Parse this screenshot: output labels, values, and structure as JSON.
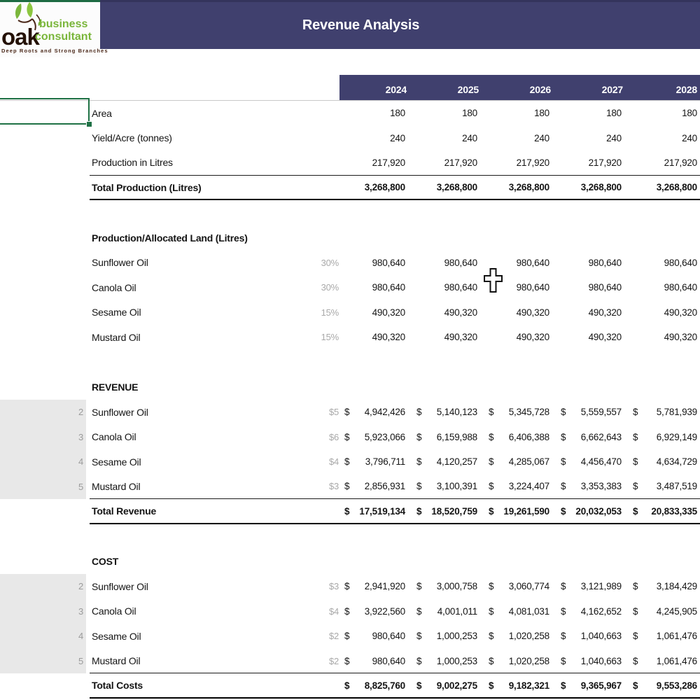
{
  "logo": {
    "brand": "oak",
    "line1": "business",
    "line2": "consultant",
    "tagline": "Deep Roots and Strong Branches"
  },
  "header": {
    "title": "Revenue Analysis"
  },
  "years": [
    "2024",
    "2025",
    "2026",
    "2027",
    "2028"
  ],
  "colors": {
    "banner": "#40406E",
    "selection_green": "#1F7145",
    "strip_gray": "#E8E8E8",
    "logo_green": "#7AB63B"
  },
  "table": {
    "rows": [
      {
        "type": "plain",
        "label": "Area",
        "values": [
          "180",
          "180",
          "180",
          "180",
          "180"
        ]
      },
      {
        "type": "plain",
        "label": "Yield/Acre (tonnes)",
        "values": [
          "240",
          "240",
          "240",
          "240",
          "240"
        ]
      },
      {
        "type": "plain",
        "label": "Production in Litres",
        "values": [
          "217,920",
          "217,920",
          "217,920",
          "217,920",
          "217,920"
        ],
        "border": "thin"
      },
      {
        "type": "total",
        "label": "Total Production (Litres)",
        "money": false,
        "values": [
          "3,268,800",
          "3,268,800",
          "3,268,800",
          "3,268,800",
          "3,268,800"
        ],
        "border": "thick"
      },
      {
        "type": "spacer"
      },
      {
        "type": "section",
        "label": "Production/Allocated Land (Litres)"
      },
      {
        "type": "plain",
        "label": "Sunflower Oil",
        "rate": "30%",
        "values": [
          "980,640",
          "980,640",
          "980,640",
          "980,640",
          "980,640"
        ]
      },
      {
        "type": "plain",
        "label": "Canola Oil",
        "rate": "30%",
        "values": [
          "980,640",
          "980,640",
          "980,640",
          "980,640",
          "980,640"
        ]
      },
      {
        "type": "plain",
        "label": "Sesame Oil",
        "rate": "15%",
        "values": [
          "490,320",
          "490,320",
          "490,320",
          "490,320",
          "490,320"
        ]
      },
      {
        "type": "plain",
        "label": "Mustard Oil",
        "rate": "15%",
        "values": [
          "490,320",
          "490,320",
          "490,320",
          "490,320",
          "490,320"
        ]
      },
      {
        "type": "spacer"
      },
      {
        "type": "section",
        "label": "REVENUE"
      },
      {
        "type": "item",
        "num": "2",
        "label": "Sunflower Oil",
        "rate": "$5",
        "money": true,
        "values": [
          "4,942,426",
          "5,140,123",
          "5,345,728",
          "5,559,557",
          "5,781,939"
        ]
      },
      {
        "type": "item",
        "num": "3",
        "label": "Canola Oil",
        "rate": "$6",
        "money": true,
        "values": [
          "5,923,066",
          "6,159,988",
          "6,406,388",
          "6,662,643",
          "6,929,149"
        ]
      },
      {
        "type": "item",
        "num": "4",
        "label": "Sesame Oil",
        "rate": "$4",
        "money": true,
        "values": [
          "3,796,711",
          "4,120,257",
          "4,285,067",
          "4,456,470",
          "4,634,729"
        ]
      },
      {
        "type": "item",
        "num": "5",
        "label": "Mustard Oil",
        "rate": "$3",
        "money": true,
        "values": [
          "2,856,931",
          "3,100,391",
          "3,224,407",
          "3,353,383",
          "3,487,519"
        ],
        "border": "thin"
      },
      {
        "type": "total",
        "label": "Total Revenue",
        "money": true,
        "values": [
          "17,519,134",
          "18,520,759",
          "19,261,590",
          "20,032,053",
          "20,833,335"
        ],
        "border": "thick"
      },
      {
        "type": "spacer"
      },
      {
        "type": "section",
        "label": "COST"
      },
      {
        "type": "item",
        "num": "2",
        "label": "Sunflower Oil",
        "rate": "$3",
        "money": true,
        "values": [
          "2,941,920",
          "3,000,758",
          "3,060,774",
          "3,121,989",
          "3,184,429"
        ]
      },
      {
        "type": "item",
        "num": "3",
        "label": "Canola Oil",
        "rate": "$4",
        "money": true,
        "values": [
          "3,922,560",
          "4,001,011",
          "4,081,031",
          "4,162,652",
          "4,245,905"
        ]
      },
      {
        "type": "item",
        "num": "4",
        "label": "Sesame Oil",
        "rate": "$2",
        "money": true,
        "values": [
          "980,640",
          "1,000,253",
          "1,020,258",
          "1,040,663",
          "1,061,476"
        ]
      },
      {
        "type": "item",
        "num": "5",
        "label": "Mustard Oil",
        "rate": "$2",
        "money": true,
        "values": [
          "980,640",
          "1,000,253",
          "1,020,258",
          "1,040,663",
          "1,061,476"
        ],
        "border": "thin"
      },
      {
        "type": "total",
        "label": "Total Costs",
        "money": true,
        "values": [
          "8,825,760",
          "9,002,275",
          "9,182,321",
          "9,365,967",
          "9,553,286"
        ],
        "border": "thick"
      }
    ]
  }
}
